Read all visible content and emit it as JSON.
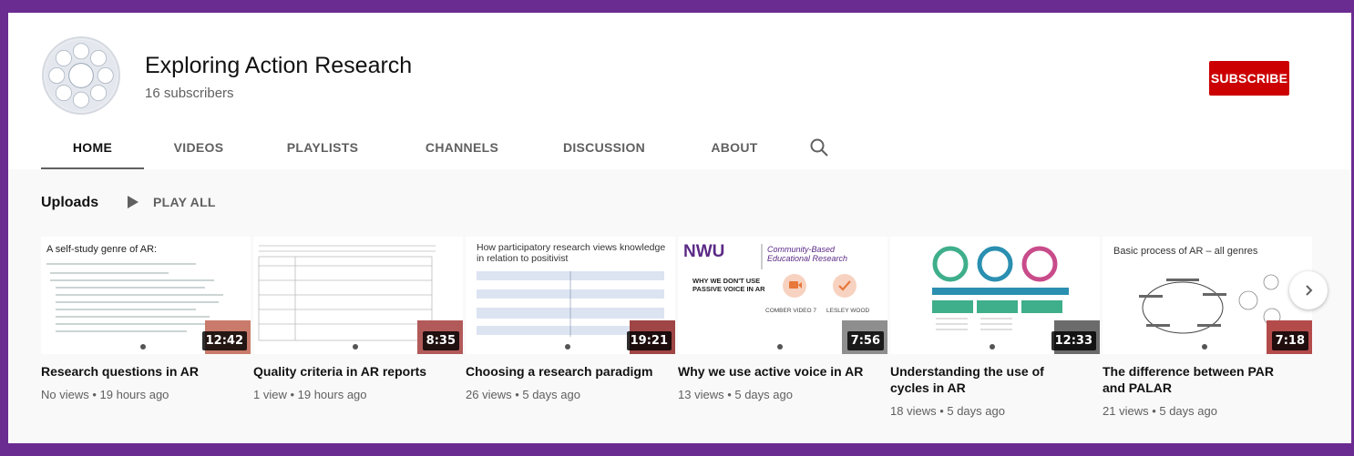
{
  "channel": {
    "name": "Exploring Action Research",
    "subscribers": "16 subscribers",
    "subscribe_label": "SUBSCRIBE",
    "brand_color": "#cc0000"
  },
  "tabs": [
    {
      "label": "HOME",
      "active": true
    },
    {
      "label": "VIDEOS"
    },
    {
      "label": "PLAYLISTS"
    },
    {
      "label": "CHANNELS"
    },
    {
      "label": "DISCUSSION"
    },
    {
      "label": "ABOUT"
    }
  ],
  "search_icon": "search-icon",
  "shelf": {
    "title": "Uploads",
    "play_all_label": "PLAY ALL",
    "next_icon": "chevron-right-icon"
  },
  "videos": [
    {
      "title": "Research questions in AR",
      "meta": "No views • 19 hours ago",
      "duration": "12:42",
      "thumb_heading": "A self-study genre of AR:"
    },
    {
      "title": "Quality criteria in AR reports",
      "meta": "1 view • 19 hours ago",
      "duration": "8:35"
    },
    {
      "title": "Choosing a research paradigm",
      "meta": "26 views • 5 days ago",
      "duration": "19:21",
      "thumb_heading": "How participatory research views knowledge in relation to positivist"
    },
    {
      "title": "Why we use active voice in AR",
      "meta": "13 views • 5 days ago",
      "duration": "7:56",
      "thumb_logo": "NWU",
      "thumb_tag": "Community-Based Educational Research",
      "thumb_heading": "WHY WE DON'T USE PASSIVE VOICE IN AR",
      "thumb_name_a": "COMBER VIDEO 7",
      "thumb_name_b": "LESLEY WOOD"
    },
    {
      "title": "Understanding the use of cycles in AR",
      "meta": "18 views • 5 days ago",
      "duration": "12:33"
    },
    {
      "title": "The difference between PAR and PALAR",
      "meta": "21 views • 5 days ago",
      "duration": "7:18",
      "thumb_heading": "Basic process of AR – all genres"
    }
  ]
}
